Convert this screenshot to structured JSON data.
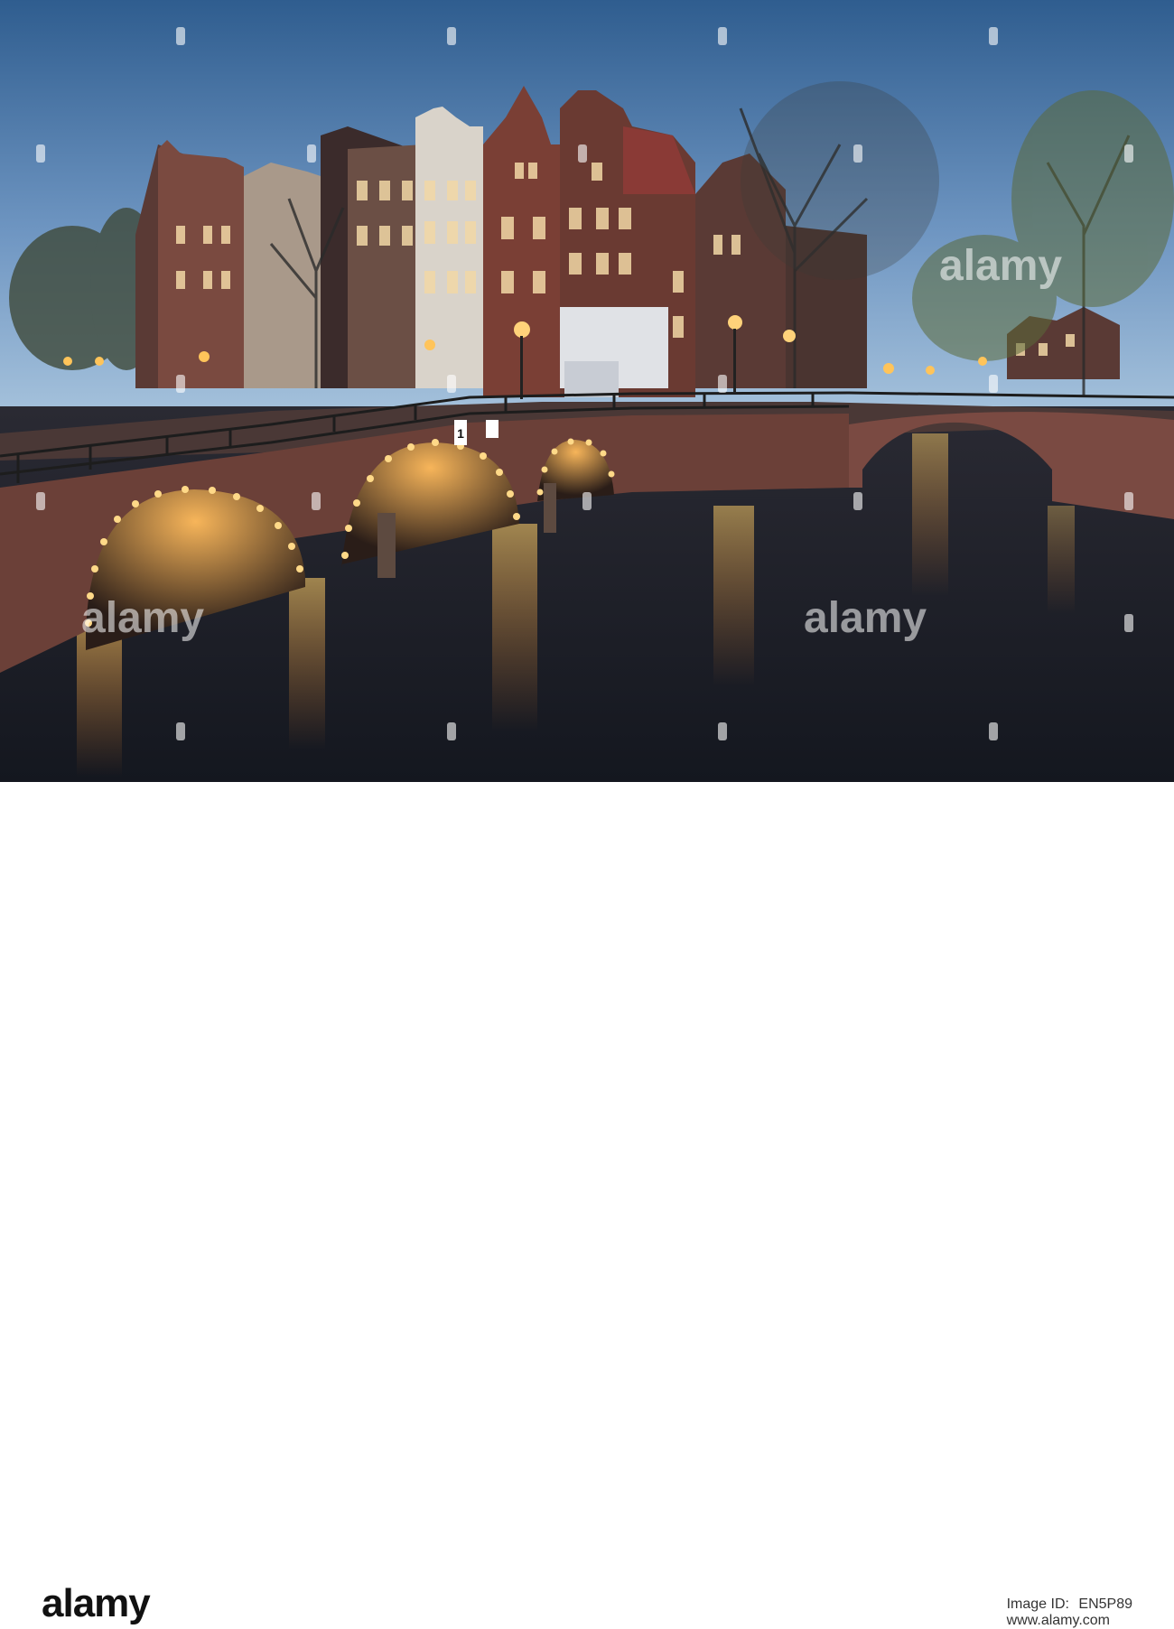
{
  "photo": {
    "subject": "canal-bridge-night",
    "colors": {
      "sky_top": "#2f5d8f",
      "sky_bottom": "#9fc0dc",
      "water": "#1a1f2a",
      "brick": "#6b4038",
      "lights": "#ffb347"
    }
  },
  "bridge_sign": {
    "text": "1"
  },
  "watermark": {
    "text": "alamy"
  },
  "footer": {
    "logo": "alamy",
    "image_id_label": "Image ID:",
    "image_id": "EN5P89",
    "site": "www.alamy.com"
  }
}
